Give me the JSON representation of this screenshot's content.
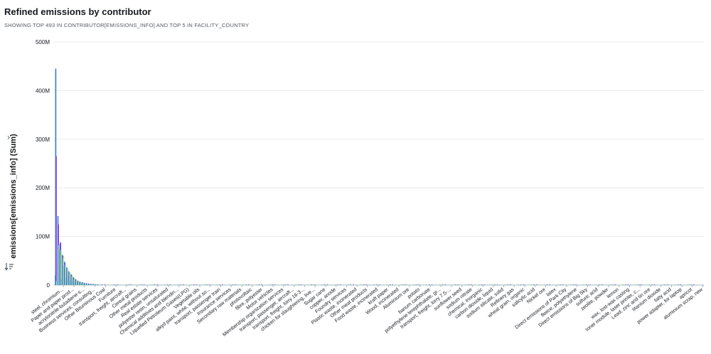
{
  "title": "Refined emissions by contributor",
  "subtitle": "SHOWING TOP 493 IN CONTRIBUTOR[EMISSIONS_INFO] AND TOP 5 IN FACILITY_COUNTRY",
  "ylabel": "emissions[emissions_info] (Sum)",
  "chart_data": {
    "type": "bar",
    "title": "Refined emissions by contributor",
    "xlabel": "",
    "ylabel": "emissions[emissions_info] (Sum)",
    "ylim": [
      0,
      500000000
    ],
    "yticks": [
      {
        "value": 0,
        "label": "0"
      },
      {
        "value": 100000000,
        "label": "100M"
      },
      {
        "value": 200000000,
        "label": "200M"
      },
      {
        "value": 300000000,
        "label": "300M"
      },
      {
        "value": 400000000,
        "label": "400M"
      },
      {
        "value": 500000000,
        "label": "500M"
      }
    ],
    "grid": true,
    "legend": "none",
    "series_colors": [
      "#3ddc97",
      "#2f7bd8",
      "#7b3fe4",
      "#8fd3f4",
      "#b8e986"
    ],
    "categories": [
      "steel, chromium...",
      "Paper and paper prod...",
      "acrylonitrile-butadiene-s...",
      "Business services; consulting...",
      "Other Bituminous Coal",
      "Furniture",
      "transport, freight, aircraft...",
      "Cereal grains",
      "Other metal products",
      "Real estate services",
      "polyester resin, unsaturated",
      "Chemical additives and blendin...",
      "Liquefied Petroleum Gases(LPG)",
      "Vegetable oils",
      "alkyd paint, white, without so...",
      "transport, passenger train",
      "Insurance services",
      "Secondary raw materials",
      "photovoltaic",
      "fibre, polyester",
      "Motor vehicles",
      "Membership organization services",
      "transport, passenger, aircraft...",
      "transport, freight, lorry 16-3...",
      "chicken for slaughtering, live...",
      "Sugar cane",
      "copper, anode",
      "Foundry services",
      "Plastic waste, incinerated",
      "Other meat products",
      "Food waste, incinerated",
      "kraft paper",
      "Wood, incinerated",
      "Aluminium ore",
      "potato",
      "barium carbonate",
      "polyethylene terephthalate, gr...",
      "transport, freight, lorry 7.5-...",
      "sunflower seed",
      "sodium nitrate",
      "chemical, inorganic",
      "carbon dioxide, liquid",
      "sodium silicate, solid",
      "Refinery gas",
      "wheat grain, organic",
      "salicylic acid",
      "Nickel ore",
      "latex",
      "Direct emissions of Park City",
      "fleece, polyethylene",
      "Direct emissions of Big Sky",
      "sulfuric acid",
      "zeolite, powder",
      "lemon",
      "wax, lost-wax casting",
      "toner module, laser printer, c...",
      "Lead, zinc and tin ore",
      "titanium dioxide",
      "fatty acid",
      "power adapter, for laptop",
      "apricot",
      "aluminium scrap, new"
    ],
    "bars": [
      {
        "x": 0,
        "series": [
          20000000,
          445000000,
          265000000,
          8000000,
          0
        ]
      },
      {
        "x": 1,
        "series": [
          0,
          142000000,
          125000000,
          82000000,
          78000000
        ]
      },
      {
        "x": 2,
        "series": [
          70000000,
          85000000,
          88000000,
          72000000,
          70000000
        ]
      },
      {
        "x": 3,
        "series": [
          12000000,
          62000000,
          60000000,
          55000000,
          60000000
        ]
      },
      {
        "x": 4,
        "series": [
          40000000,
          48000000,
          45000000,
          42000000,
          40000000
        ]
      },
      {
        "x": 5,
        "series": [
          15000000,
          36000000,
          30000000,
          34000000,
          32000000
        ]
      },
      {
        "x": 6,
        "series": [
          20000000,
          28000000,
          25000000,
          26000000,
          24000000
        ]
      },
      {
        "x": 7,
        "series": [
          10000000,
          22000000,
          20000000,
          18000000,
          20000000
        ]
      },
      {
        "x": 8,
        "series": [
          8000000,
          16000000,
          14000000,
          12000000,
          14000000
        ]
      },
      {
        "x": 9,
        "series": [
          6000000,
          12000000,
          11000000,
          10000000,
          9000000
        ]
      },
      {
        "x": 10,
        "series": [
          5000000,
          9000000,
          8000000,
          7000000,
          8000000
        ]
      },
      {
        "x": 11,
        "series": [
          4000000,
          7000000,
          6000000,
          6000000,
          5000000
        ]
      },
      {
        "x": 12,
        "series": [
          3000000,
          6000000,
          5000000,
          4000000,
          5000000
        ]
      },
      {
        "x": 13,
        "series": [
          3000000,
          4500000,
          4000000,
          4000000,
          3000000
        ]
      },
      {
        "x": 14,
        "series": [
          2000000,
          3500000,
          3000000,
          3000000,
          2500000
        ]
      },
      {
        "x": 15,
        "series": [
          2000000,
          3000000,
          2500000,
          2000000,
          2000000
        ]
      },
      {
        "x": 16,
        "series": [
          1500000,
          2500000,
          2000000,
          2000000,
          1500000
        ]
      },
      {
        "x": 17,
        "series": [
          1000000,
          2000000,
          2000000,
          1500000,
          1500000
        ]
      },
      {
        "x": 18,
        "series": [
          1000000,
          1500000,
          1500000,
          1200000,
          1000000
        ]
      },
      {
        "x": 19,
        "series": [
          800000,
          1200000,
          1200000,
          1000000,
          1000000
        ]
      }
    ],
    "tail_value": 800000
  }
}
